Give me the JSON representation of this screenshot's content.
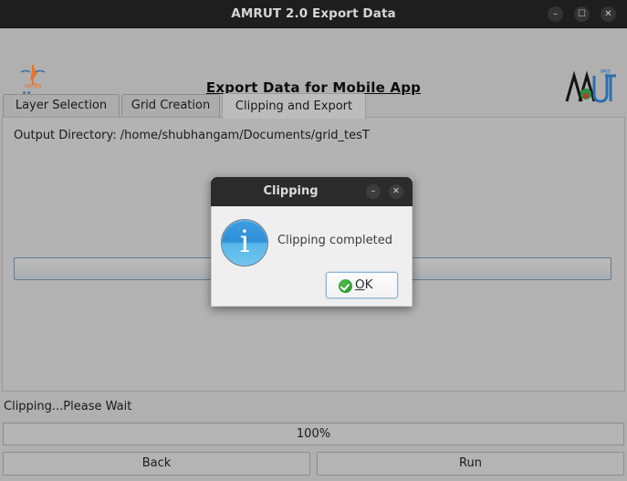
{
  "window": {
    "title": "AMRUT 2.0 Export Data",
    "controls": {
      "minimize": "–",
      "maximize": "☐",
      "close": "✕"
    }
  },
  "header": {
    "heading": "Export Data for Mobile App",
    "left_logo": "iirs-logo",
    "left_logo_text": "iirs",
    "right_logo": "amrut-logo"
  },
  "tabs": [
    {
      "label": "Layer Selection",
      "active": false
    },
    {
      "label": "Grid Creation",
      "active": false
    },
    {
      "label": "Clipping and Export",
      "active": true
    }
  ],
  "panel": {
    "output_directory": "Output Directory: /home/shubhangam/Documents/grid_tesT",
    "field_value": ""
  },
  "footer": {
    "status": "Clipping...Please Wait",
    "progress_label": "100%",
    "progress_percent": 100,
    "back_label": "Back",
    "run_label": "Run"
  },
  "dialog": {
    "title": "Clipping",
    "message": "Clipping completed",
    "icon": "info-icon",
    "icon_glyph": "i",
    "ok_label_underlined": "O",
    "ok_label_rest": "K",
    "controls": {
      "minimize": "–",
      "close": "✕"
    }
  },
  "colors": {
    "window_chrome": "#1e1e1e",
    "app_background": "#b0b0b0",
    "tab_active": "#bcbcbc",
    "dialog_background": "#efefef",
    "info_blue": "#2e8fd8",
    "ok_green": "#2e9e2e",
    "field_border": "#64798a"
  }
}
